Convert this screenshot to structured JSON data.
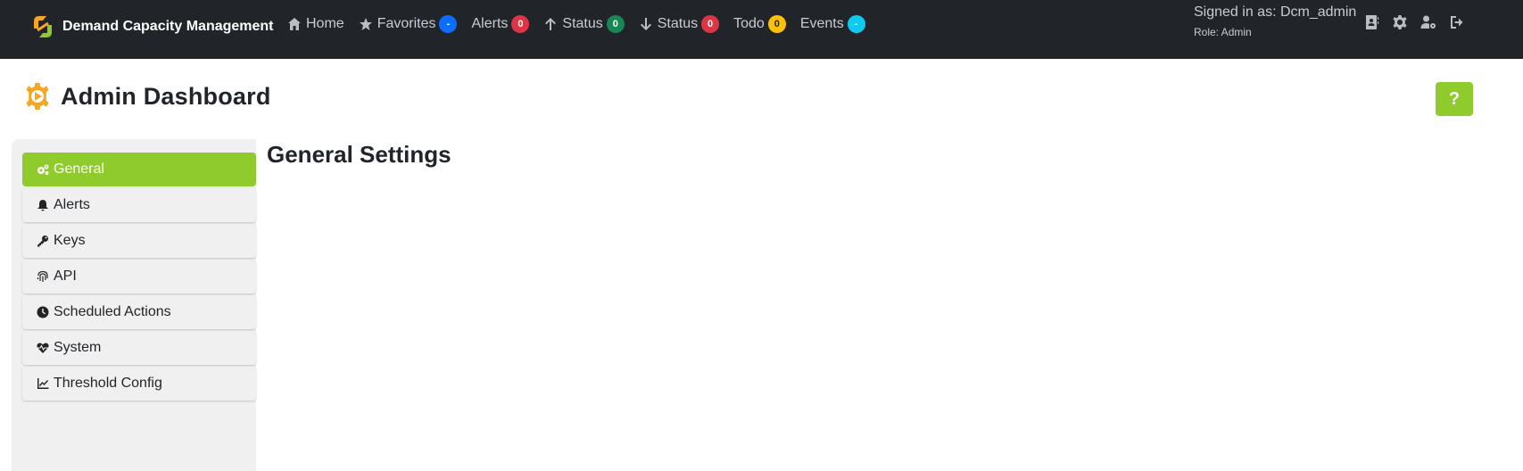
{
  "app": {
    "title": "Demand Capacity Management"
  },
  "nav": {
    "items": [
      {
        "label": "Home",
        "icon": "home-icon",
        "badge": null,
        "badge_color": null
      },
      {
        "label": "Favorites",
        "icon": "star-icon",
        "badge": "-",
        "badge_color": "#0d6efd"
      },
      {
        "label": "Alerts",
        "icon": null,
        "badge": "0",
        "badge_color": "#dc3545"
      },
      {
        "label": "Status",
        "icon": "arrow-up-icon",
        "badge": "0",
        "badge_color": "#198754"
      },
      {
        "label": "Status",
        "icon": "arrow-down-icon",
        "badge": "0",
        "badge_color": "#dc3545"
      },
      {
        "label": "Todo",
        "icon": null,
        "badge": "0",
        "badge_color": "#ffc107"
      },
      {
        "label": "Events",
        "icon": null,
        "badge": "-",
        "badge_color": "#0dcaf0"
      }
    ]
  },
  "user": {
    "signed_in": "Signed in as: Dcm_admin",
    "role": "Role: Admin"
  },
  "top_icons": [
    "address-book-icon",
    "gear-icon",
    "user-gear-icon",
    "sign-out-icon"
  ],
  "page": {
    "title": "Admin Dashboard",
    "help_label": "?"
  },
  "sidebar": {
    "items": [
      {
        "label": "General",
        "icon": "gears-icon",
        "active": true
      },
      {
        "label": "Alerts",
        "icon": "bell-icon",
        "active": false
      },
      {
        "label": "Keys",
        "icon": "key-icon",
        "active": false
      },
      {
        "label": "API",
        "icon": "fingerprint-icon",
        "active": false
      },
      {
        "label": "Scheduled Actions",
        "icon": "clock-icon",
        "active": false
      },
      {
        "label": "System",
        "icon": "heart-pulse-icon",
        "active": false
      },
      {
        "label": "Threshold Config",
        "icon": "chart-line-icon",
        "active": false
      }
    ]
  },
  "content": {
    "title": "General Settings"
  },
  "colors": {
    "navbar": "#212529",
    "accent": "#8fcb2c",
    "logo_orange": "#f5a623",
    "logo_green": "#8fcb2c"
  }
}
